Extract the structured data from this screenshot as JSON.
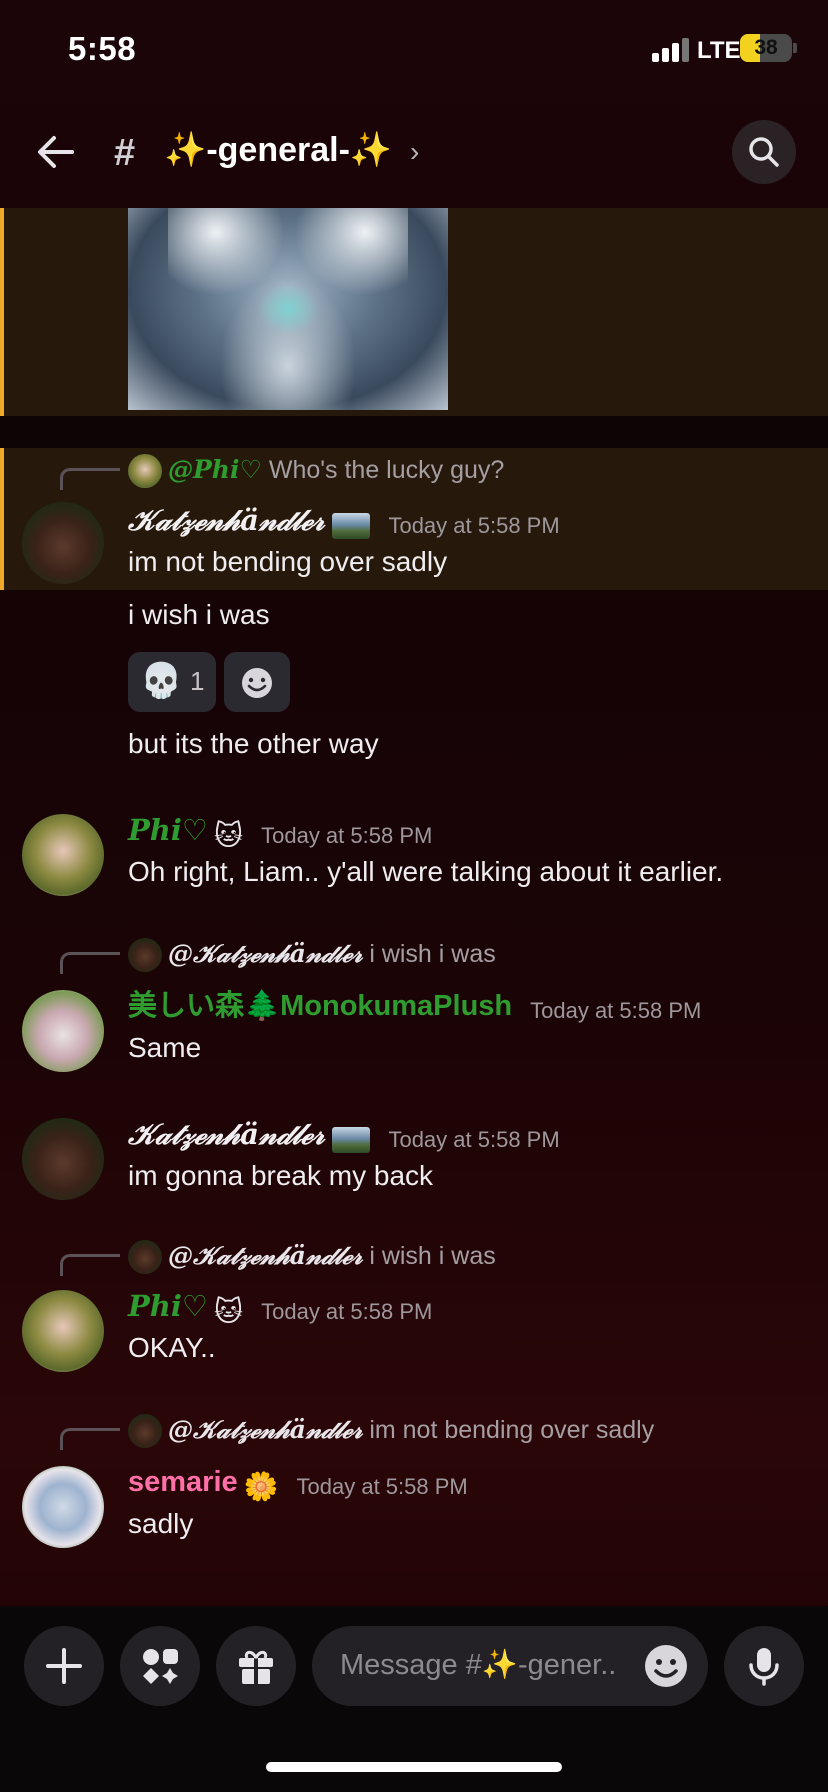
{
  "status_bar": {
    "time": "5:58",
    "network": "LTE",
    "battery": "38",
    "battery_level": 0.38
  },
  "header": {
    "hash": "#",
    "channel_name": "✨-general-✨",
    "chevron": "›",
    "back_icon": "arrow-left-icon",
    "search_icon": "search-icon"
  },
  "messages": [
    {
      "reply": {
        "name": "@Phi♡",
        "text": "Who's the lucky guy?"
      },
      "author": "𝒦𝒶𝓉𝓏ℯ𝓃𝒽ä𝓃𝒹𝓁ℯ𝓇",
      "timestamp": "Today at 5:58 PM",
      "lines": [
        "im not bending over sadly",
        "i wish i was"
      ],
      "reactions": [
        {
          "emoji": "💀",
          "count": "1"
        }
      ],
      "extra_line": "but its the other way"
    },
    {
      "author": "Phi♡",
      "badge": "🐱",
      "timestamp": "Today at 5:58 PM",
      "lines": [
        "Oh right, Liam.. y'all were talking about it earlier."
      ]
    },
    {
      "reply": {
        "name": "@𝒦𝒶𝓉𝓏ℯ𝓃𝒽ä𝓃𝒹𝓁ℯ𝓇",
        "text": "i wish i was"
      },
      "author": "美しい森🌲MonokumaPlush",
      "timestamp": "Today at 5:58 PM",
      "lines": [
        "Same"
      ]
    },
    {
      "author": "𝒦𝒶𝓉𝓏ℯ𝓃𝒽ä𝓃𝒹𝓁ℯ𝓇",
      "timestamp": "Today at 5:58 PM",
      "lines": [
        "im gonna break my back"
      ]
    },
    {
      "reply": {
        "name": "@𝒦𝒶𝓉𝓏ℯ𝓃𝒽ä𝓃𝒹𝓁ℯ𝓇",
        "text": "i wish i was"
      },
      "author": "Phi♡",
      "badge": "🐱",
      "timestamp": "Today at 5:58 PM",
      "lines": [
        "OKAY.."
      ]
    },
    {
      "reply": {
        "name": "@𝒦𝒶𝓉𝓏ℯ𝓃𝒽ä𝓃𝒹𝓁ℯ𝓇",
        "text": "im not bending over sadly"
      },
      "author": "semarie",
      "badge": "🌼",
      "timestamp": "Today at 5:58 PM",
      "lines": [
        "sadly"
      ]
    }
  ],
  "composer": {
    "placeholder": "Message #✨-gener..",
    "icons": [
      "plus-icon",
      "apps-icon",
      "gift-icon",
      "emoji-icon",
      "microphone-icon"
    ]
  },
  "colors": {
    "highlight_bar": "#f0a82a",
    "green_name": "#2f9c2f",
    "pink_name": "#ff6fa8"
  }
}
